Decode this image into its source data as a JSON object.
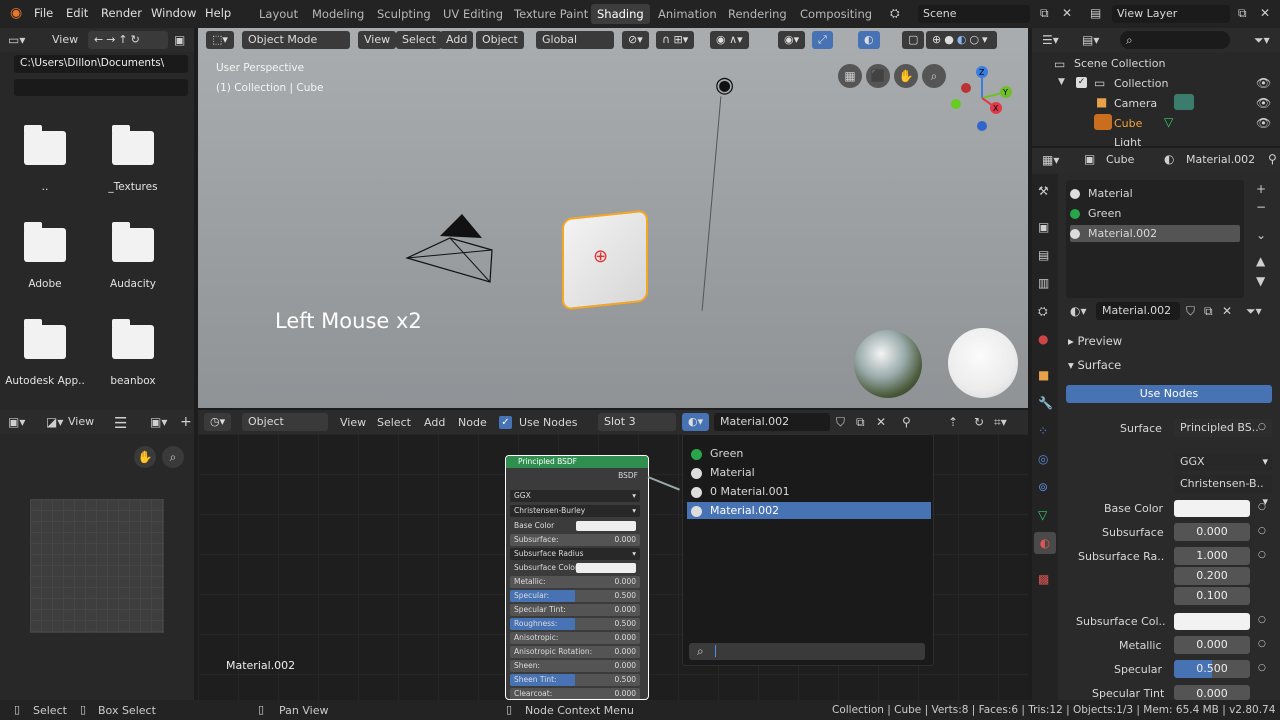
{
  "menu": {
    "file": "File",
    "edit": "Edit",
    "render": "Render",
    "window": "Window",
    "help": "Help"
  },
  "workspaces": [
    "Layout",
    "Modeling",
    "Sculpting",
    "UV Editing",
    "Texture Paint",
    "Shading",
    "Animation",
    "Rendering",
    "Compositing"
  ],
  "scene": {
    "name": "Scene",
    "view_layer": "View Layer"
  },
  "filebrowser": {
    "view_label": "View",
    "path": "C:\\Users\\Dillon\\Documents\\",
    "items": [
      "..",
      "_Textures",
      "Adobe",
      "Audacity",
      "Autodesk App..",
      "beanbox"
    ]
  },
  "viewport": {
    "mode": "Object Mode",
    "view": "View",
    "select": "Select",
    "add": "Add",
    "object": "Object",
    "orientation": "Global",
    "perspective": "User Perspective",
    "collection": "(1) Collection | Cube",
    "overlay_text": "Left Mouse x2"
  },
  "node_header": {
    "mode": "Object",
    "view": "View",
    "select": "Select",
    "add": "Add",
    "node": "Node",
    "use_nodes": "Use Nodes",
    "slot": "Slot 3",
    "material": "Material.002"
  },
  "node_editor": {
    "material_label": "Material.002",
    "node_title": "Principled BSDF",
    "output": "BSDF",
    "rows": [
      {
        "label": "GGX",
        "value": ""
      },
      {
        "label": "Christensen-Burley",
        "value": ""
      },
      {
        "label": "Base Color",
        "value": ""
      },
      {
        "label": "Subsurface:",
        "value": "0.000"
      },
      {
        "label": "Subsurface Radius",
        "value": ""
      },
      {
        "label": "Subsurface Color",
        "value": ""
      },
      {
        "label": "Metallic:",
        "value": "0.000"
      },
      {
        "label": "Specular:",
        "value": "0.500"
      },
      {
        "label": "Specular Tint:",
        "value": "0.000"
      },
      {
        "label": "Roughness:",
        "value": "0.500"
      },
      {
        "label": "Anisotropic:",
        "value": "0.000"
      },
      {
        "label": "Anisotropic Rotation:",
        "value": "0.000"
      },
      {
        "label": "Sheen:",
        "value": "0.000"
      },
      {
        "label": "Sheen Tint:",
        "value": "0.500"
      },
      {
        "label": "Clearcoat:",
        "value": "0.000"
      }
    ]
  },
  "material_popup": {
    "items": [
      "Green",
      "Material",
      "0 Material.001",
      "Material.002"
    ],
    "selected": "Material.002"
  },
  "uv_panel": {
    "view": "View"
  },
  "outliner": {
    "scene_collection": "Scene Collection",
    "collection": "Collection",
    "camera": "Camera",
    "cube": "Cube",
    "light": "Light"
  },
  "properties": {
    "object": "Cube",
    "material": "Material.002",
    "slots": [
      "Material",
      "Green",
      "Material.002"
    ],
    "material_field": "Material.002",
    "preview": "Preview",
    "surface_panel": "Surface",
    "use_nodes": "Use Nodes",
    "surface_label": "Surface",
    "surface_value": "Principled BS..",
    "distribution": "GGX",
    "subsurface_method": "Christensen-B..",
    "base_color": "Base Color",
    "subsurface": "Subsurface",
    "subsurface_value": "0.000",
    "subsurface_radius": "Subsurface Ra..",
    "radius_values": [
      "1.000",
      "0.200",
      "0.100"
    ],
    "subsurface_color": "Subsurface Col..",
    "metallic": "Metallic",
    "metallic_value": "0.000",
    "specular": "Specular",
    "specular_value": "0.500",
    "specular_tint": "Specular Tint",
    "specular_tint_value": "0.000"
  },
  "statusbar": {
    "select": "Select",
    "box_select": "Box Select",
    "pan_view": "Pan View",
    "context_menu": "Node Context Menu",
    "stats": "Collection | Cube | Verts:8 | Faces:6 | Tris:12 | Objects:1/3 | Mem: 65.4 MB | v2.80.74"
  },
  "colors": {
    "accent": "#4772b3",
    "selection": "#f5a623",
    "header_green": "#2f8f4f"
  }
}
